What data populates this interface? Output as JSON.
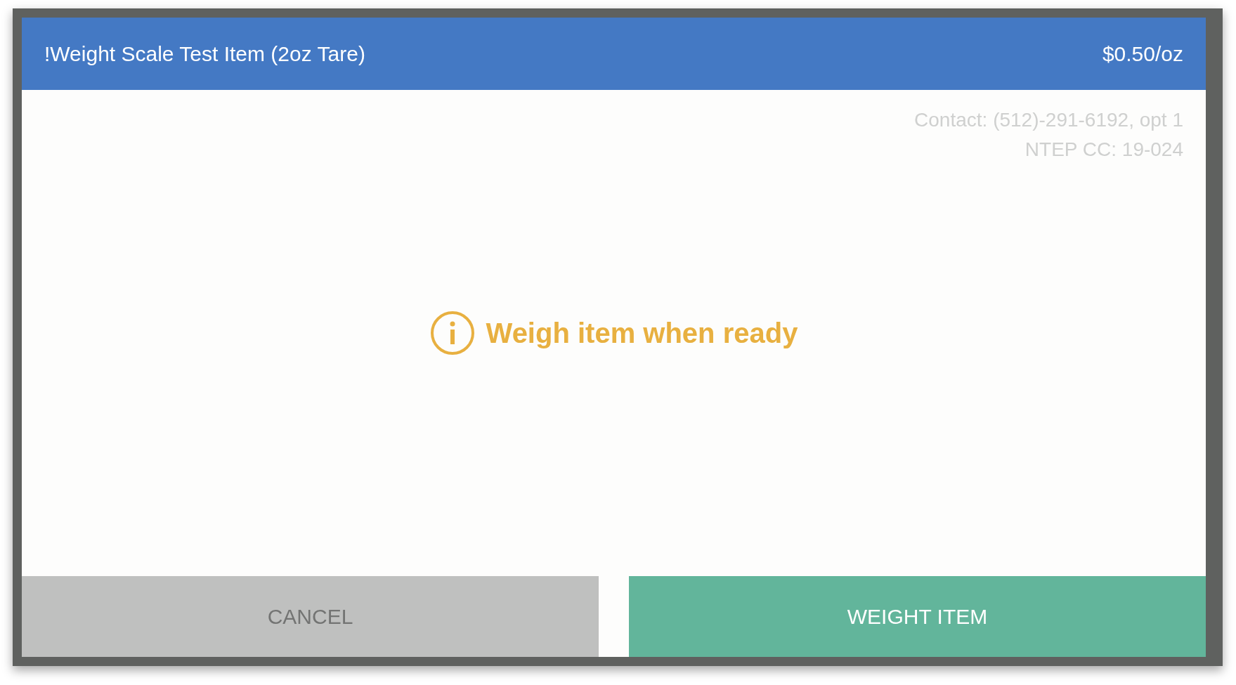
{
  "dialog": {
    "title": "!Weight Scale Test Item (2oz Tare)",
    "price": "$0.50/oz",
    "info_lines": [
      "Contact: (512)-291-6192, opt 1",
      "NTEP CC: 19-024"
    ],
    "message": "Weigh item when ready",
    "buttons": [
      {
        "label": "CANCEL",
        "kind": "secondary"
      },
      {
        "label": "WEIGHT ITEM",
        "kind": "primary"
      }
    ]
  }
}
